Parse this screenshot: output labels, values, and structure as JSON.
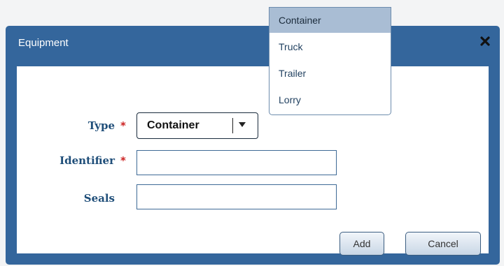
{
  "dialog": {
    "title": "Equipment",
    "close_icon": "close-x-icon"
  },
  "form": {
    "type": {
      "label": "Type",
      "required_mark": "*",
      "value": "Container",
      "arrow_icon": "caret-down-icon"
    },
    "identifier": {
      "label": "Identifier",
      "required_mark": "*",
      "value": ""
    },
    "seals": {
      "label": "Seals",
      "value": ""
    }
  },
  "buttons": {
    "add_label": "Add",
    "cancel_label": "Cancel"
  },
  "dropdown": {
    "options": [
      "Container",
      "Truck",
      "Trailer",
      "Lorry"
    ],
    "selected": "Container"
  },
  "colors": {
    "header": "#34669c",
    "label": "#1f4e79",
    "required": "#cc2222",
    "selected_option": "#a9bdd4"
  }
}
